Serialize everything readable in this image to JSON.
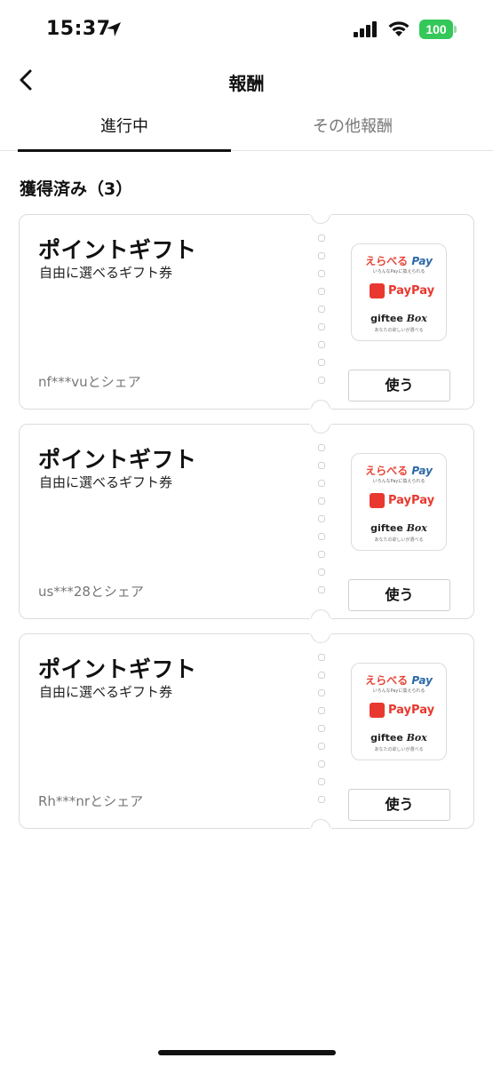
{
  "status_bar": {
    "time": "15:37",
    "battery": "100"
  },
  "nav": {
    "title": "報酬"
  },
  "tabs": [
    {
      "label": "進行中",
      "active": true
    },
    {
      "label": "その他報酬",
      "active": false
    }
  ],
  "section": {
    "title": "獲得済み（3）"
  },
  "cards": [
    {
      "title": "ポイントギフト",
      "subtitle": "自由に選べるギフト券",
      "share": "nf***vuとシェア",
      "button": "使う",
      "logos": {
        "erabe_red": "えらべる",
        "erabe_blue": "Pay",
        "erabe_sub": "いろんなPayに換えられる",
        "paypay": "PayPay",
        "giftee": "giftee",
        "giftee_box": "Box",
        "giftee_sub": "あなたの欲しいが選べる"
      }
    },
    {
      "title": "ポイントギフト",
      "subtitle": "自由に選べるギフト券",
      "share": "us***28とシェア",
      "button": "使う",
      "logos": {
        "erabe_red": "えらべる",
        "erabe_blue": "Pay",
        "erabe_sub": "いろんなPayに換えられる",
        "paypay": "PayPay",
        "giftee": "giftee",
        "giftee_box": "Box",
        "giftee_sub": "あなたの欲しいが選べる"
      }
    },
    {
      "title": "ポイントギフト",
      "subtitle": "自由に選べるギフト券",
      "share": "Rh***nrとシェア",
      "button": "使う",
      "logos": {
        "erabe_red": "えらべる",
        "erabe_blue": "Pay",
        "erabe_sub": "いろんなPayに換えられる",
        "paypay": "PayPay",
        "giftee": "giftee",
        "giftee_box": "Box",
        "giftee_sub": "あなたの欲しいが選べる"
      }
    }
  ],
  "icons": [
    "location-arrow-icon",
    "cellular-signal-icon",
    "wifi-icon",
    "battery-icon",
    "back-chevron-icon",
    "paypay-logo-icon"
  ],
  "colors": {
    "battery_green": "#34c759",
    "paypay_red": "#e8382f",
    "erabe_red": "#e5473a",
    "erabe_blue": "#2d6aa8"
  }
}
